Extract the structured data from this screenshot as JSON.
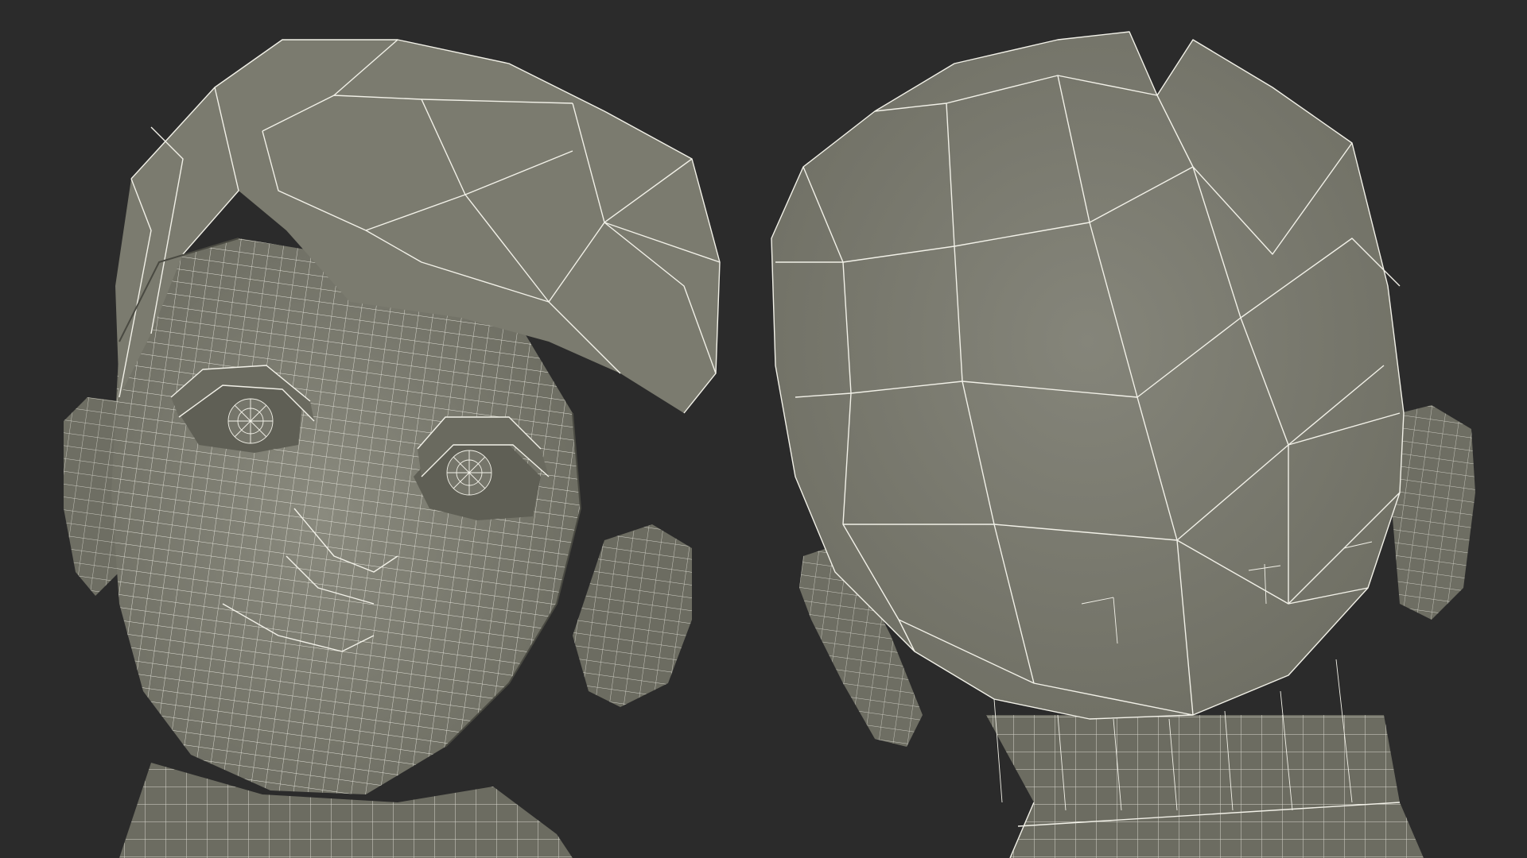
{
  "scene": {
    "background_color": "#2b2b2b",
    "mesh_color": "#7a7a6e",
    "wire_color": "#f2f1e8",
    "views": [
      {
        "name": "front-three-quarter-view"
      },
      {
        "name": "back-view"
      }
    ]
  }
}
